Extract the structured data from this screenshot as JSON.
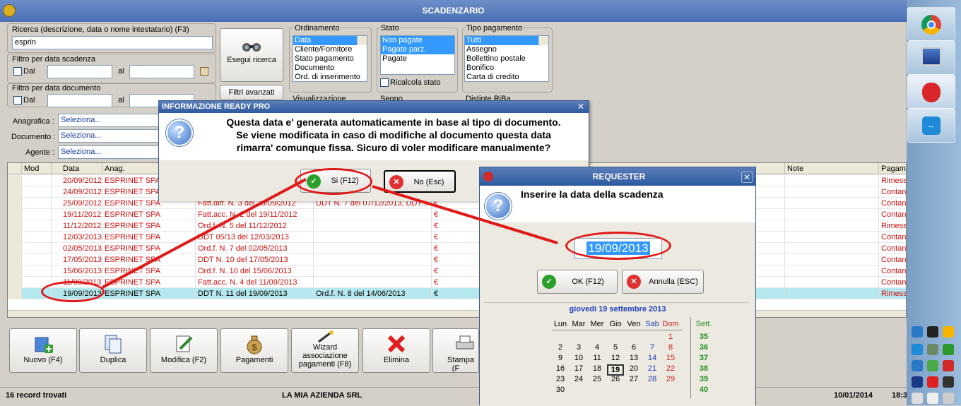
{
  "window": {
    "title": "SCADENZARIO"
  },
  "search": {
    "label": "Ricerca (descrizione, data o nome intestatario) (F3)",
    "value": "esprin",
    "button": "Esegui ricerca"
  },
  "filtro_scadenza": {
    "label": "Filtro per data scadenza",
    "dal": "Dal",
    "al": "al"
  },
  "filtro_documento": {
    "label": "Filtro per data documento",
    "dal": "Dal",
    "al": "al"
  },
  "filtri_avanzati": "Filtri avanzati",
  "ordinamento": {
    "label": "Ordinamento",
    "items": [
      "Data",
      "Cliente/Fornitore",
      "Stato pagamento",
      "Documento",
      "Ord. di inserimento"
    ]
  },
  "stato": {
    "label": "Stato",
    "items": [
      "Non pagate",
      "Pagate parz.",
      "Pagate"
    ],
    "ricalcola": "Ricalcola stato"
  },
  "tipo_pagamento": {
    "label": "Tipo pagamento",
    "items": [
      "Tutti",
      "Assegno",
      "Bollettino postale",
      "Bonifico",
      "Carta di credito"
    ]
  },
  "partial_labels": {
    "visualizzazione": "Visualizzazione",
    "segno": "Segno",
    "distinte": "Distinte RiBa"
  },
  "filters": {
    "anagrafica": {
      "label": "Anagrafica :",
      "value": "Seleziona..."
    },
    "documento": {
      "label": "Documento :",
      "value": "Seleziona..."
    },
    "agente": {
      "label": "Agente :",
      "value": "Seleziona..."
    }
  },
  "grid": {
    "columns": [
      "Mod",
      "Data",
      "Anag.",
      "",
      "",
      "",
      "Note",
      "Pagame"
    ],
    "rows": [
      {
        "data": "20/09/2012",
        "anag": "ESPRINET SPA",
        "doc": "",
        "ord": "",
        "cur": "",
        "pag": "Rimessa diretta",
        "red": true
      },
      {
        "data": "24/09/2012",
        "anag": "ESPRINET SPA",
        "doc": "",
        "ord": "",
        "cur": "",
        "pag": "Contanti",
        "red": true
      },
      {
        "data": "25/09/2012",
        "anag": "ESPRINET SPA",
        "doc": "Fatt.diff. N. 3 del 25/09/2012",
        "ord": "DDT N. 7 del 07/12/2013, DDT...",
        "cur": "€",
        "pag": "Contanti",
        "red": true
      },
      {
        "data": "19/11/2012",
        "anag": "ESPRINET SPA",
        "doc": "Fatt.acc. N. 2 del 19/11/2012",
        "ord": "",
        "cur": "€",
        "pag": "Contanti",
        "red": true
      },
      {
        "data": "11/12/2012",
        "anag": "ESPRINET SPA",
        "doc": "Ord.f. N. 5 del 11/12/2012",
        "ord": "",
        "cur": "€",
        "pag": "Rimessa diretta",
        "red": true
      },
      {
        "data": "12/03/2013",
        "anag": "ESPRINET SPA",
        "doc": "DDT 05/13 del 12/03/2013",
        "ord": "",
        "cur": "€",
        "pag": "Contanti",
        "red": true
      },
      {
        "data": "02/05/2013",
        "anag": "ESPRINET SPA",
        "doc": "Ord.f. N. 7 del 02/05/2013",
        "ord": "",
        "cur": "€",
        "pag": "Contanti",
        "red": true
      },
      {
        "data": "17/05/2013",
        "anag": "ESPRINET SPA",
        "doc": "DDT N. 10 del 17/05/2013",
        "ord": "",
        "cur": "€",
        "pag": "Contanti",
        "red": true
      },
      {
        "data": "15/06/2013",
        "anag": "ESPRINET SPA",
        "doc": "Ord.f. N. 10 del 15/06/2013",
        "ord": "",
        "cur": "€",
        "pag": "Contanti",
        "red": true
      },
      {
        "data": "11/09/2013",
        "anag": "ESPRINET SPA",
        "doc": "Fatt.acc. N. 4 del 11/09/2013",
        "ord": "",
        "cur": "€",
        "pag": "Contanti",
        "red": true
      },
      {
        "data": "19/09/2013",
        "anag": "ESPRINET SPA",
        "doc": "DDT N. 11 del 19/09/2013",
        "ord": "Ord.f. N. 8 del 14/06/2013",
        "cur": "€",
        "pag": "Rimessa diretta",
        "red": false
      }
    ]
  },
  "toolbar": {
    "nuovo": "Nuovo (F4)",
    "duplica": "Duplica",
    "modifica": "Modifica (F2)",
    "pagamenti": "Pagamenti",
    "wizard": "Wizard associazione pagamenti (F8)",
    "elimina": "Elimina",
    "stampa": "Stampa (F"
  },
  "status": {
    "records": "16 record trovati",
    "azienda": "LA MIA AZIENDA SRL",
    "date": "10/01/2014",
    "time": "18:3"
  },
  "dialog_info": {
    "title": "INFORMAZIONE READY PRO",
    "line1": "Questa data e' generata automaticamente in base al tipo di documento.",
    "line2": "Se viene modificata in caso di modifiche al documento questa data",
    "line3": "rimarra' comunque fissa. Sicuro di voler modificare manualmente?",
    "yes": "Si (F12)",
    "no": "No (Esc)"
  },
  "requester": {
    "title": "REQUESTER",
    "prompt": "Inserire la data della scadenza",
    "value": "19/09/2013",
    "ok": "OK (F12)",
    "annulla": "Annulla (ESC)",
    "cal_title": "giovedì 19 settembre 2013",
    "weekdays": [
      "Lun",
      "Mar",
      "Mer",
      "Gio",
      "Ven",
      "Sab",
      "Dom"
    ],
    "sett_label": "Sett.",
    "weeks": [
      {
        "n": "35",
        "days": [
          "",
          "",
          "",
          "",
          "",
          "",
          "1"
        ]
      },
      {
        "n": "36",
        "days": [
          "2",
          "3",
          "4",
          "5",
          "6",
          "7",
          "8"
        ]
      },
      {
        "n": "37",
        "days": [
          "9",
          "10",
          "11",
          "12",
          "13",
          "14",
          "15"
        ]
      },
      {
        "n": "38",
        "days": [
          "16",
          "17",
          "18",
          "19",
          "20",
          "21",
          "22"
        ]
      },
      {
        "n": "39",
        "days": [
          "23",
          "24",
          "25",
          "26",
          "27",
          "28",
          "29"
        ]
      },
      {
        "n": "40",
        "days": [
          "30",
          "",
          "",
          "",
          "",
          "",
          ""
        ]
      }
    ]
  },
  "colors": {
    "accent": "#e01818",
    "title": "#2c5aa0",
    "selection": "#3399ff",
    "highlight_row": "#b5e8ee"
  }
}
